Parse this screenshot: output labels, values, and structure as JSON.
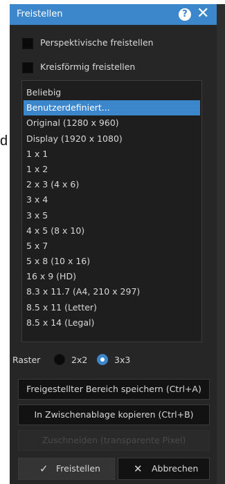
{
  "background": {
    "left_text": "d"
  },
  "dialog": {
    "title": "Freistellen",
    "help_icon": "question-icon",
    "close_icon": "close-icon",
    "close_glyph": "✕",
    "help_glyph": "?",
    "accent_color": "#3c87cc"
  },
  "options": {
    "perspective_label": "Perspektivische freistellen",
    "perspective_checked": false,
    "circular_label": "Kreisförmig freistellen",
    "circular_checked": false
  },
  "ratio_list": {
    "selected_index": 1,
    "items": [
      "Beliebig",
      "Benutzerdefiniert...",
      "Original (1280 x 960)",
      "Display (1920 x 1080)",
      "1 x 1",
      "1 x 2",
      "2 x 3 (4 x 6)",
      "3 x 4",
      "3 x 5",
      "4 x 5 (8 x 10)",
      "5 x 7",
      "5 x 8 (10 x 16)",
      "16 x 9 (HD)",
      "8.3 x 11.7 (A4, 210 x 297)",
      "8.5 x 11 (Letter)",
      "8.5 x 14 (Legal)"
    ]
  },
  "raster": {
    "label": "Raster",
    "option_2x2": "2x2",
    "option_3x3": "3x3",
    "selected": "3x3"
  },
  "actions": {
    "save_region": "Freigestellter Bereich speichern (Ctrl+A)",
    "copy_clipboard": "In Zwischenablage kopieren (Ctrl+B)",
    "crop_transparent": "Zuschneiden (transparente Pixel)"
  },
  "footer": {
    "confirm_label": "Freistellen",
    "confirm_glyph": "✓",
    "cancel_label": "Abbrechen",
    "cancel_glyph": "✕"
  }
}
